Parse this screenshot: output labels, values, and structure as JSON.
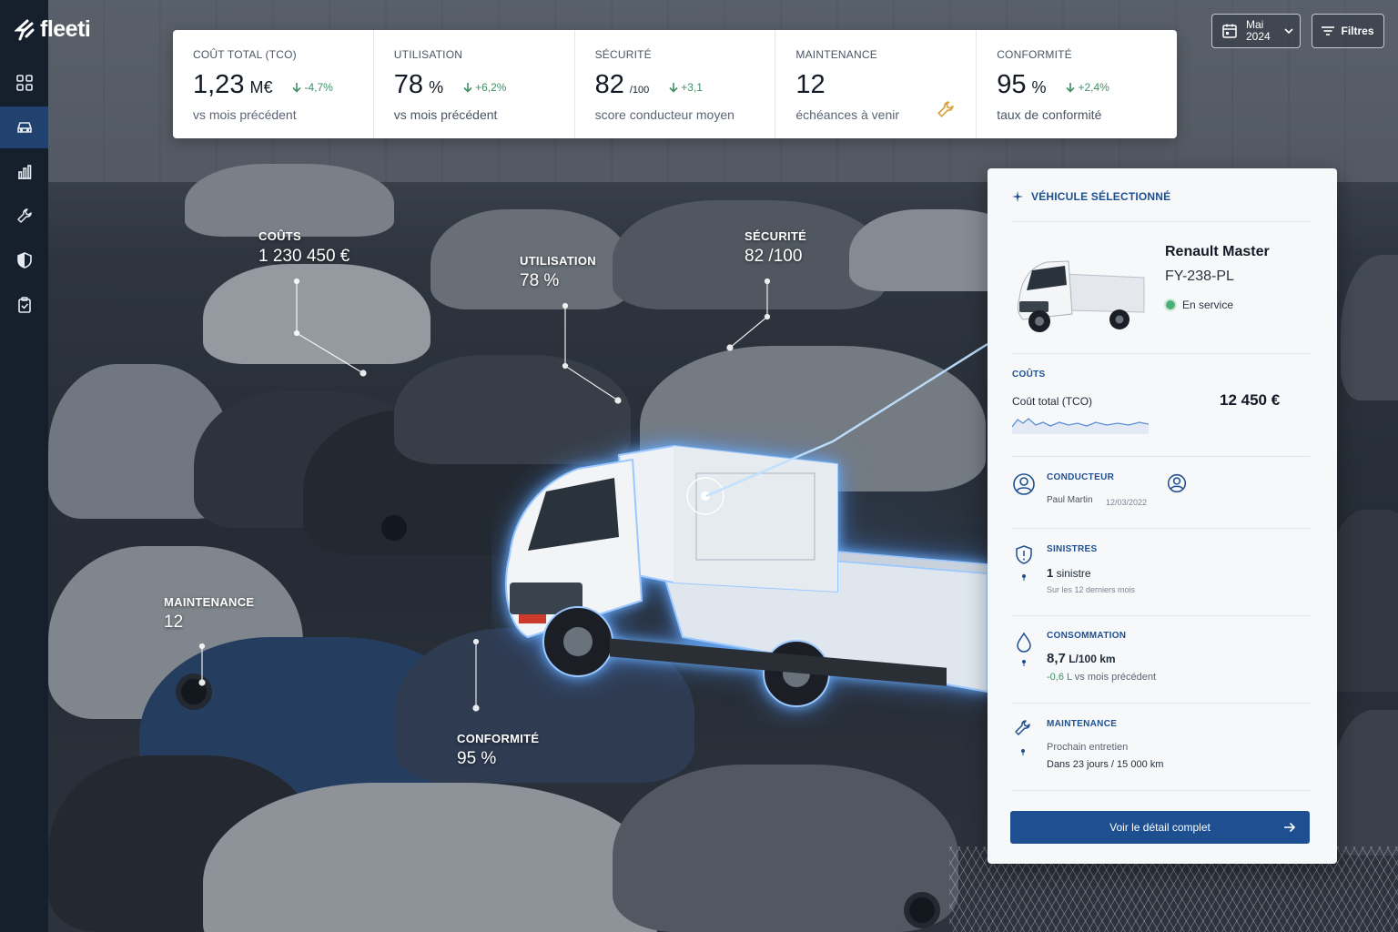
{
  "app": {
    "logo": "fleeti"
  },
  "sidebar": {
    "items": [
      {
        "id": "dashboard",
        "icon": "grid-icon",
        "active": false
      },
      {
        "id": "vehicles",
        "icon": "car-icon",
        "active": true
      },
      {
        "id": "reports",
        "icon": "bar-chart-icon",
        "active": false
      },
      {
        "id": "maintenance",
        "icon": "wrench-icon",
        "active": false
      },
      {
        "id": "security",
        "icon": "shield-icon",
        "active": false
      },
      {
        "id": "compliance",
        "icon": "clipboard-check-icon",
        "active": false
      }
    ]
  },
  "header": {
    "month": "Mai",
    "year": "2024",
    "filters_label": "Filtres"
  },
  "kpis": [
    {
      "label": "COÛT TOTAL (TCO)",
      "value": "1,23",
      "unit": "M€",
      "delta": "-4,7%",
      "sub": "vs mois précédent"
    },
    {
      "label": "UTILISATION",
      "value": "78",
      "unit": "%",
      "delta": "+6,2%",
      "sub": "vs mois précédent"
    },
    {
      "label": "SÉCURITÉ",
      "value": "82",
      "unit": "/100",
      "delta": "+3,1",
      "sub": "score conducteur moyen"
    },
    {
      "label": "MAINTENANCE",
      "value": "12",
      "unit": "",
      "delta": "",
      "sub": "échéances à venir"
    },
    {
      "label": "CONFORMITÉ",
      "value": "95",
      "unit": "%",
      "delta": "+2,4%",
      "sub": "taux de conformité"
    }
  ],
  "overlays": {
    "couts": {
      "title": "COÛTS",
      "value": "1 230 450 €"
    },
    "utilisation": {
      "title": "UTILISATION",
      "value": "78 %"
    },
    "securite": {
      "title": "SÉCURITÉ",
      "value": "82 /100"
    },
    "maintenance": {
      "title": "MAINTENANCE",
      "value": "12"
    },
    "conformite": {
      "title": "CONFORMITÉ",
      "value": "95 %"
    }
  },
  "panel": {
    "header": "VÉHICULE SÉLECTIONNÉ",
    "vehicle": {
      "name": "Renault Master",
      "plate": "FY-238-PL",
      "status": "En service"
    },
    "couts": {
      "title": "COÛTS",
      "label": "Coût total (TCO)",
      "value": "12 450 €"
    },
    "conducteur": {
      "title": "CONDUCTEUR",
      "name": "Paul Martin",
      "date": "12/03/2022"
    },
    "sinistres": {
      "title": "SINISTRES",
      "count": "1",
      "count_label": "sinistre",
      "sub": "Sur les 12 derniers mois"
    },
    "consommation": {
      "title": "CONSOMMATION",
      "value": "8,7",
      "unit": "L/100 km",
      "delta": "-0,6 L",
      "delta_label": "vs mois précédent"
    },
    "maintenance": {
      "title": "MAINTENANCE",
      "line1": "Prochain entretien",
      "line2": "Dans 23 jours / 15 000 km"
    },
    "cta": "Voir le détail complet"
  },
  "colors": {
    "accent": "#1d4f91",
    "positive": "#3f8f67",
    "warning": "#d9a441",
    "sidebar": "#16202d"
  }
}
